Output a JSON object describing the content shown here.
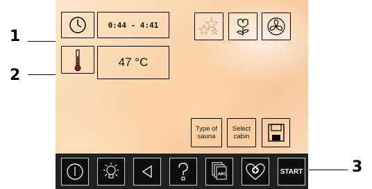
{
  "time_display": {
    "value": "0:44 - 4:41"
  },
  "temperature_display": {
    "value": "47 °C"
  },
  "buttons": {
    "type_of_sauna": "Type of\nsauna",
    "select_cabin": "Select\ncabin"
  },
  "toolbar": {
    "start_label": "START"
  },
  "callouts": [
    "1",
    "2",
    "3"
  ],
  "icons": {
    "clock": "clock-icon",
    "thermometer": "thermometer-icon",
    "stars": "stars-icon",
    "flower": "flower-icon",
    "fan": "fan-icon",
    "save": "floppy-disk-icon",
    "power": "power-icon",
    "light": "light-bulb-icon",
    "back": "back-arrow-icon",
    "help": "help-icon",
    "language": "language-pages-icon",
    "health": "heart-plus-icon"
  }
}
